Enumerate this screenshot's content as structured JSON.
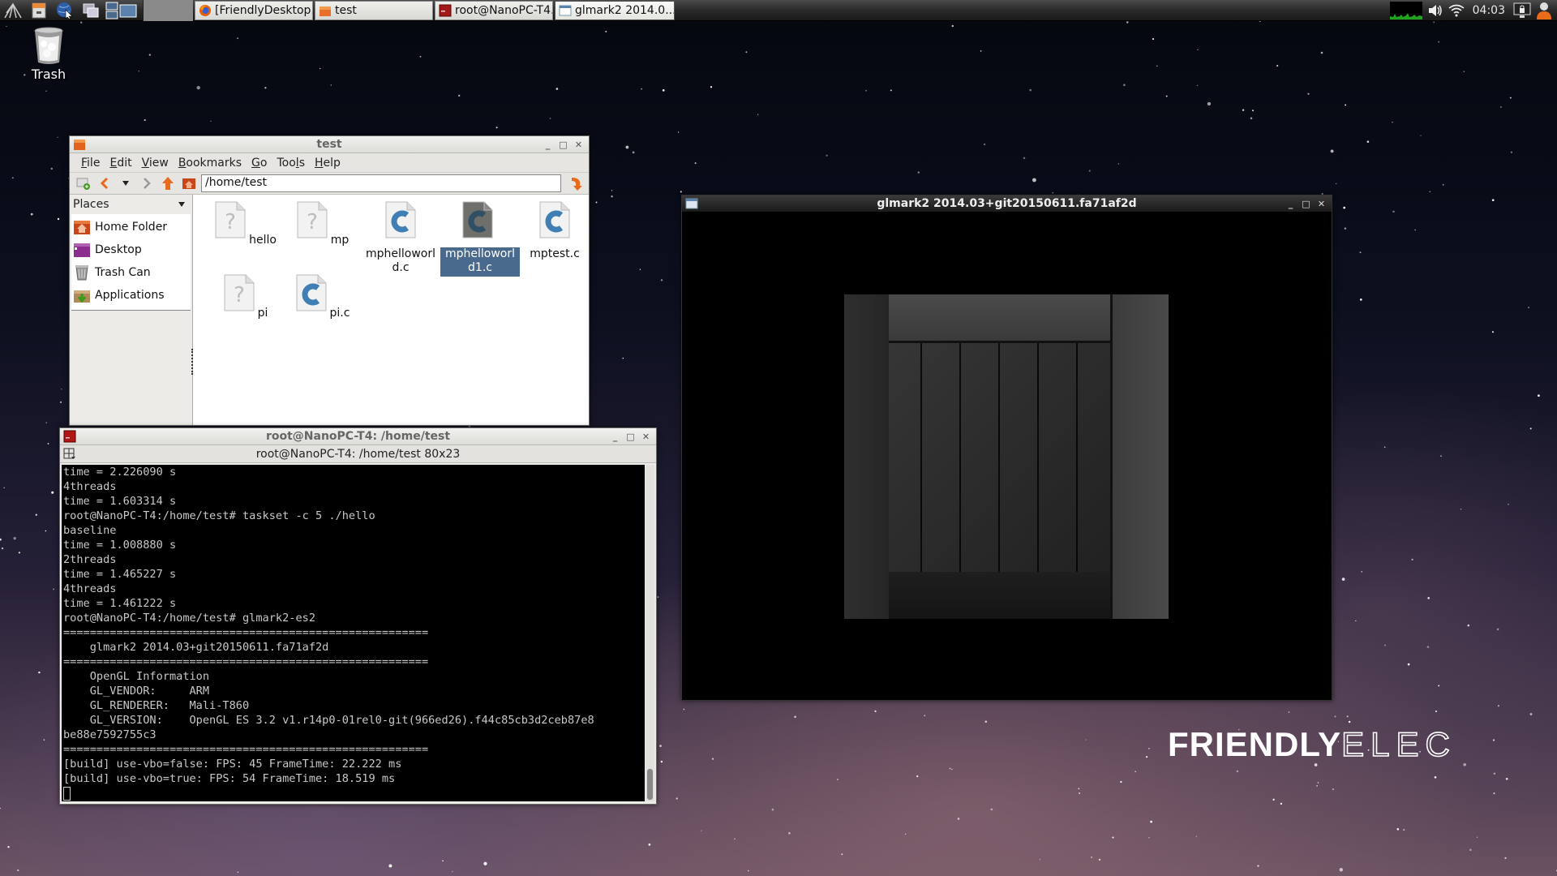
{
  "taskbar": {
    "launchers": [
      {
        "name": "menu-icon"
      },
      {
        "name": "file-manager-icon"
      },
      {
        "name": "browser-icon"
      },
      {
        "name": "show-desktop-icon"
      },
      {
        "name": "workspace-pager-icon"
      }
    ],
    "tasks": [
      {
        "label": "[FriendlyDesktop...",
        "icon": "firefox-icon",
        "active": false
      },
      {
        "label": "test",
        "icon": "folder-icon",
        "active": false
      },
      {
        "label": "root@NanoPC-T4...",
        "icon": "terminal-icon",
        "active": false
      },
      {
        "label": "glmark2 2014.0...",
        "icon": "window-icon",
        "active": true
      }
    ],
    "tray": {
      "clock": "04:03",
      "icons": [
        "cpu-monitor-icon",
        "volume-icon",
        "wifi-icon",
        "lock-screen-icon",
        "user-icon"
      ]
    }
  },
  "desktop": {
    "icons": [
      {
        "label": "Trash",
        "icon": "trash-icon"
      }
    ],
    "logo": {
      "bold": "FRIENDLY",
      "outline": "ELEC"
    }
  },
  "file_manager": {
    "title": "test",
    "menu": [
      "File",
      "Edit",
      "View",
      "Bookmarks",
      "Go",
      "Tools",
      "Help"
    ],
    "menu_mnemonics": [
      "F",
      "E",
      "V",
      "B",
      "G",
      "l",
      "H"
    ],
    "path": "/home/test",
    "places_header": "Places",
    "places": [
      {
        "label": "Home Folder",
        "icon": "home-folder-icon"
      },
      {
        "label": "Desktop",
        "icon": "desktop-icon"
      },
      {
        "label": "Trash Can",
        "icon": "trash-can-icon"
      },
      {
        "label": "Applications",
        "icon": "applications-icon"
      }
    ],
    "files": [
      {
        "name": "hello",
        "type": "unknown",
        "selected": false
      },
      {
        "name": "mp",
        "type": "unknown",
        "selected": false
      },
      {
        "name": "mphelloworl\nd.c",
        "type": "c-source",
        "selected": false
      },
      {
        "name": "mphelloworl\nd1.c",
        "type": "c-source",
        "selected": true
      },
      {
        "name": "mptest.c",
        "type": "c-source",
        "selected": false
      },
      {
        "name": "pi",
        "type": "unknown",
        "selected": false
      },
      {
        "name": "pi.c",
        "type": "c-source",
        "selected": false
      }
    ]
  },
  "terminal": {
    "title": "root@NanoPC-T4: /home/test",
    "subtitle": "root@NanoPC-T4: /home/test 80x23",
    "lines": [
      "time = 2.226090 s",
      "4threads",
      "time = 1.603314 s",
      "root@NanoPC-T4:/home/test# taskset -c 5 ./hello",
      "baseline",
      "time = 1.008880 s",
      "2threads",
      "time = 1.465227 s",
      "4threads",
      "time = 1.461222 s",
      "root@NanoPC-T4:/home/test# glmark2-es2",
      "=======================================================",
      "    glmark2 2014.03+git20150611.fa71af2d",
      "=======================================================",
      "    OpenGL Information",
      "    GL_VENDOR:     ARM",
      "    GL_RENDERER:   Mali-T860",
      "    GL_VERSION:    OpenGL ES 3.2 v1.r14p0-01rel0-git(966ed26).f44c85cb3d2ceb87e8",
      "be88e7592755c3",
      "=======================================================",
      "[build] use-vbo=false: FPS: 45 FrameTime: 22.222 ms",
      "[build] use-vbo=true: FPS: 54 FrameTime: 18.519 ms"
    ]
  },
  "glmark": {
    "title": "glmark2 2014.03+git20150611.fa71af2d",
    "scene": "wooden-crate"
  },
  "window_buttons": {
    "minimize": "_",
    "maximize": "□",
    "close": "✕"
  }
}
